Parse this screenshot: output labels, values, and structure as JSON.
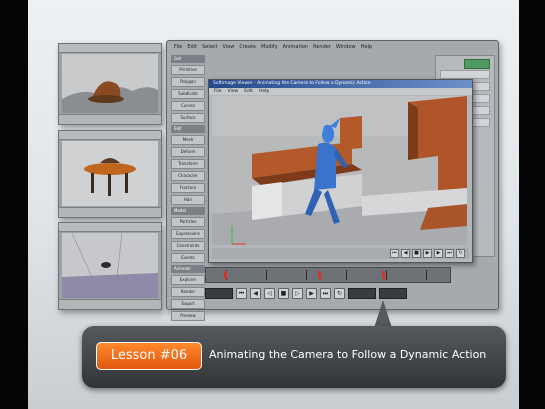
{
  "app": {
    "menu": [
      "File",
      "Edit",
      "Select",
      "View",
      "Create",
      "Modify",
      "Animation",
      "Render",
      "Window",
      "Help"
    ],
    "side_buttons": [
      "Primitive",
      "Polygon",
      "Subdivide",
      "Curves",
      "Surface",
      "Mesh",
      "Deform",
      "Transform",
      "Character",
      "Fracture",
      "Hair",
      "Particles",
      "Expressions",
      "Constraints",
      "Events",
      "Explorer",
      "Render",
      "Export",
      "Preview"
    ],
    "side_headers": [
      "Get",
      "Edit",
      "Model",
      "Animate"
    ]
  },
  "viewer": {
    "title": "Softimage Viewer - Animating the Camera to Follow a Dynamic Action",
    "menu": [
      "File",
      "View",
      "Edit",
      "Help"
    ]
  },
  "banner": {
    "lesson": "Lesson #06",
    "title": "Animating the Camera to Follow a Dynamic Action"
  },
  "colors": {
    "accent": "#e8661a",
    "banner_bg": "#45484c",
    "scene_orange": "#b35a2a",
    "character_blue": "#3b76d6"
  }
}
